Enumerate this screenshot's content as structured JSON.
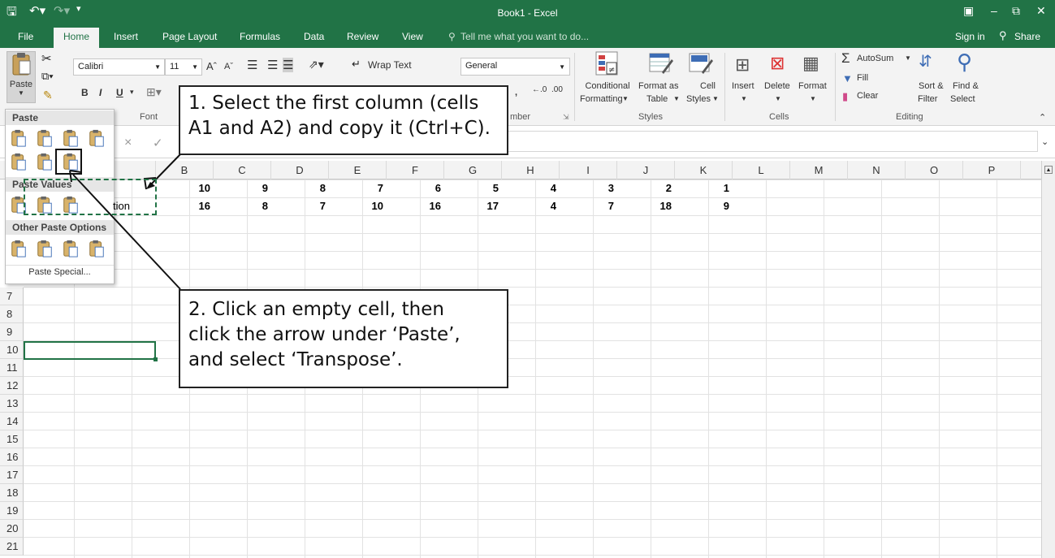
{
  "window": {
    "title": "Book1 - Excel"
  },
  "tabs": [
    "File",
    "Home",
    "Insert",
    "Page Layout",
    "Formulas",
    "Data",
    "Review",
    "View"
  ],
  "active_tab": "Home",
  "tell_me": "Tell me what you want to do...",
  "account": {
    "sign_in": "Sign in",
    "share": "Share"
  },
  "ribbon": {
    "clipboard": {
      "paste": "Paste"
    },
    "font": {
      "name": "Calibri",
      "size": "11",
      "bold": "B",
      "italic": "I",
      "underline": "U",
      "group": "Font"
    },
    "alignment": {
      "wrap_text": "Wrap Text"
    },
    "number": {
      "format": "General",
      "group_partial": "mber"
    },
    "styles": {
      "conditional": [
        "Conditional",
        "Formatting"
      ],
      "format_as": [
        "Format as",
        "Table"
      ],
      "cell_styles": [
        "Cell",
        "Styles"
      ],
      "group": "Styles"
    },
    "cells": {
      "insert": "Insert",
      "delete": "Delete",
      "format": "Format",
      "group": "Cells"
    },
    "editing": {
      "autosum": "AutoSum",
      "fill": "Fill",
      "clear": "Clear",
      "sort": [
        "Sort &",
        "Filter"
      ],
      "find": [
        "Find &",
        "Select"
      ],
      "group": "Editing"
    }
  },
  "paste_menu": {
    "header": "Paste",
    "values_header": "Paste Values",
    "other_header": "Other Paste Options",
    "special": "Paste Special..."
  },
  "columns": [
    "B",
    "C",
    "D",
    "E",
    "F",
    "G",
    "H",
    "I",
    "J",
    "K",
    "L",
    "M",
    "N",
    "O",
    "P"
  ],
  "rows": [
    "7",
    "8",
    "9",
    "10",
    "11",
    "12",
    "13",
    "14",
    "15",
    "16",
    "17",
    "18",
    "19",
    "20",
    "21"
  ],
  "data_rows": [
    {
      "a": "",
      "values": [
        "10",
        "9",
        "8",
        "7",
        "6",
        "5",
        "4",
        "3",
        "2",
        "1"
      ]
    },
    {
      "a": "tion",
      "values": [
        "16",
        "8",
        "7",
        "10",
        "16",
        "17",
        "4",
        "7",
        "18",
        "9"
      ]
    }
  ],
  "callouts": {
    "step1": [
      "1. Select the first column (cells",
      "A1 and A2) and copy it (Ctrl+C)."
    ],
    "step2": [
      "2. Click an empty cell, then",
      "click the arrow under ‘Paste’,",
      "and select ‘Transpose’."
    ]
  },
  "colors": {
    "excel_green": "#217346",
    "selection": "#217346"
  }
}
